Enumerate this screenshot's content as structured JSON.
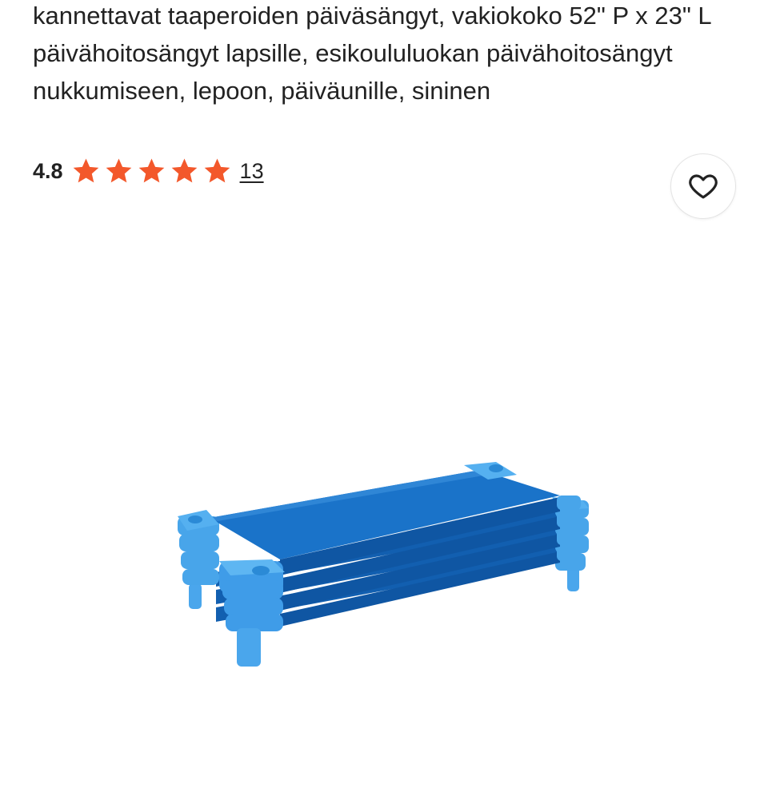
{
  "product": {
    "title": "kannettavat taaperoiden päiväsängyt, vakiokoko 52\" P x 23\" L päivähoitosängyt lapsille, esikoululuokan päivähoitosängyt nukkumiseen, lepoon, päiväunille, sininen",
    "rating": "4.8",
    "rating_stars": 5,
    "review_count": "13",
    "image_alt": "blue stackable toddler cots"
  },
  "colors": {
    "star": "#f3582b",
    "text": "#222222",
    "cot_blue": "#1a73c9",
    "cot_frame": "#3d9be6"
  },
  "icons": {
    "wishlist": "heart-icon",
    "rating": "star-icon"
  }
}
